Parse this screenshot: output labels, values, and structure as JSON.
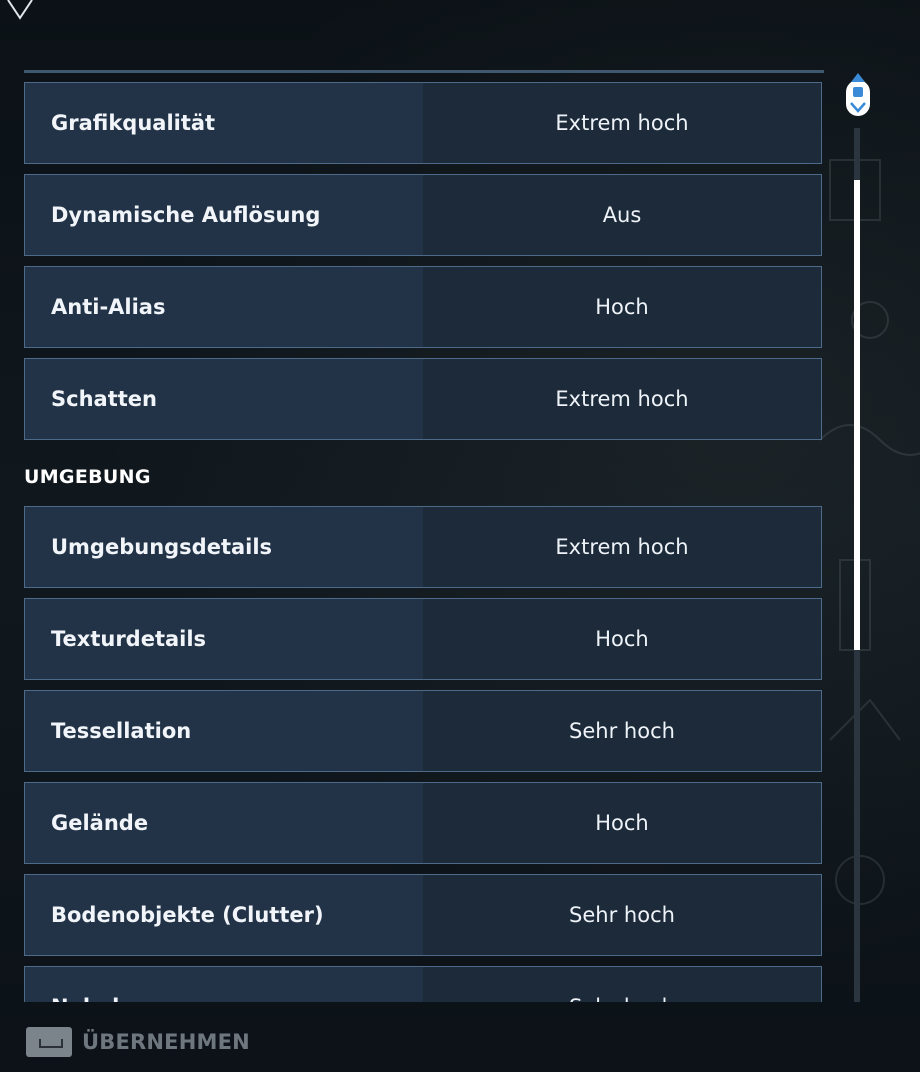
{
  "settings_top": [
    {
      "label": "Grafikqualität",
      "value": "Extrem hoch"
    },
    {
      "label": "Dynamische Auflösung",
      "value": "Aus"
    },
    {
      "label": "Anti-Alias",
      "value": "Hoch"
    },
    {
      "label": "Schatten",
      "value": "Extrem hoch"
    }
  ],
  "section": {
    "title": "UMGEBUNG"
  },
  "settings_env": [
    {
      "label": "Umgebungsdetails",
      "value": "Extrem hoch"
    },
    {
      "label": "Texturdetails",
      "value": "Hoch"
    },
    {
      "label": "Tessellation",
      "value": "Sehr hoch"
    },
    {
      "label": "Gelände",
      "value": "Hoch"
    },
    {
      "label": "Bodenobjekte (Clutter)",
      "value": "Sehr hoch"
    },
    {
      "label": "Nebel",
      "value": "Sehr hoch"
    }
  ],
  "footer": {
    "apply_label": "ÜBERNEHMEN",
    "apply_key_icon": "spacebar-icon"
  },
  "scrollbar": {
    "position": 0.05
  },
  "colors": {
    "row_left": "#223347",
    "row_right": "#1c2a3a",
    "row_border": "#4d6b88",
    "background": "#0d1419",
    "disabled_text": "#6f777e"
  }
}
